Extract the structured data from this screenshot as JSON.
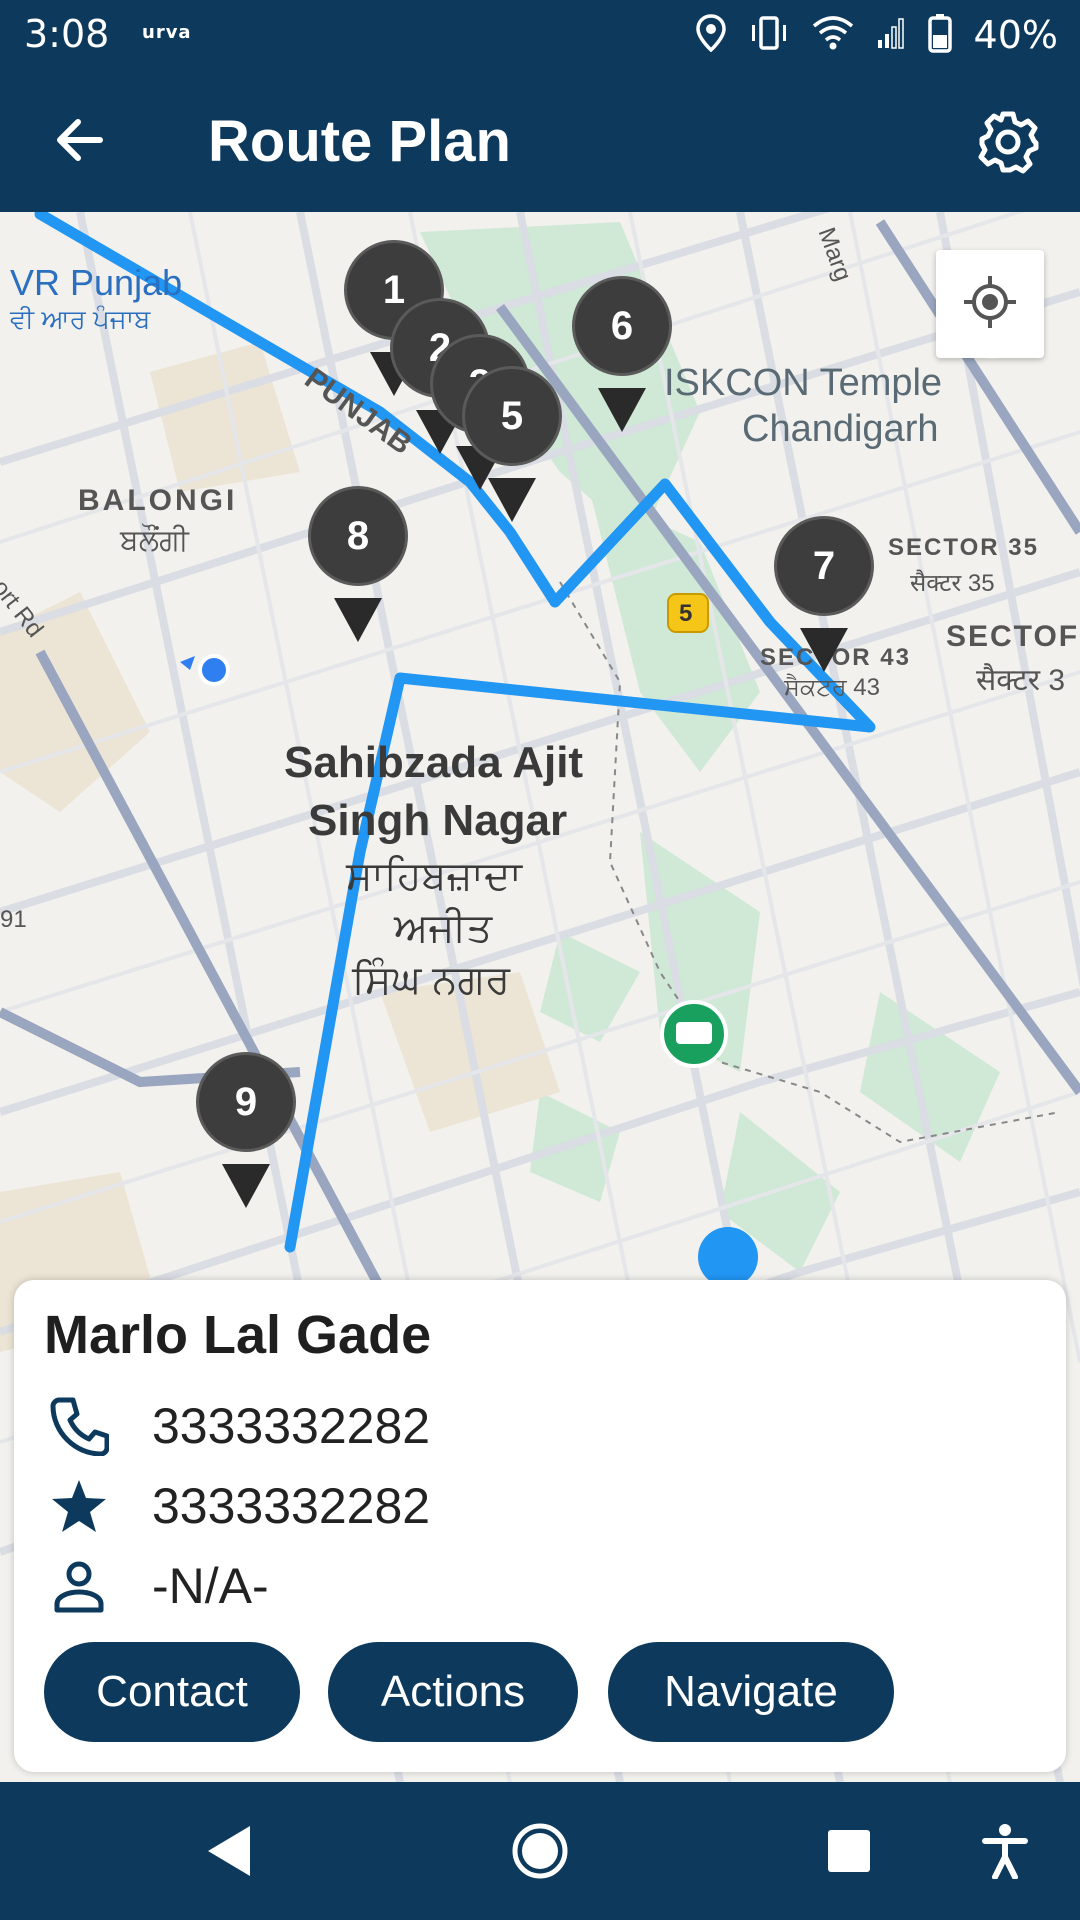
{
  "status_bar": {
    "time": "3:08",
    "carrier": "urva",
    "battery": "40%",
    "icons": [
      "location-icon",
      "vibrate-icon",
      "wifi-icon",
      "signal-icon",
      "battery-icon"
    ]
  },
  "app_bar": {
    "title": "Route Plan",
    "back_icon": "arrow-back-icon",
    "settings_icon": "gear-icon"
  },
  "map": {
    "markers": [
      "1",
      "2",
      "3",
      "5",
      "6",
      "7",
      "8",
      "9"
    ],
    "labels": {
      "vr_punjab": "VR Punjab",
      "vr_punjab_pa": "ਵੀ ਆਰ ਪੰਜਾਬ",
      "balongi": "BALONGI",
      "balongi_pa": "ਬਲੌਂਗੀ",
      "punjab_road": "PUNJAB",
      "iskcon": "ISKCON Temple",
      "iskcon2": "Chandigarh",
      "sector35": "SECTOR 35",
      "sector35_hi": "सैक्टर 35",
      "sector43": "SECTOR 43",
      "sector43_pa": "ਸੈਕਟਰ 43",
      "sector_edge": "SECTOF",
      "sector_edge_hi": "सैक्टर 3",
      "city1": "Sahibzada Ajit",
      "city2": "Singh Nagar",
      "city_pa1": "ਸਾਹਿਬਜ਼ਾਦਾ",
      "city_pa2": "ਅਜੀਤ",
      "city_pa3": "ਸਿੰਘ ਨਗਰ",
      "airport_rd": "port Rd",
      "marg": "Marg",
      "road_badge": "5",
      "edge_91": "91"
    },
    "route_color": "#2196f3"
  },
  "card": {
    "name": "Marlo Lal Gade",
    "phone": "3333332282",
    "alt_phone": "3333332282",
    "contact_person": "-N/A-",
    "buttons": {
      "contact": "Contact",
      "actions": "Actions",
      "navigate": "Navigate"
    }
  },
  "nav_bar": {
    "icons": [
      "back-triangle-icon",
      "home-circle-icon",
      "recents-square-icon",
      "accessibility-icon"
    ]
  },
  "colors": {
    "primary": "#0d3a5c",
    "route": "#2196f3",
    "marker": "#3d3d3d"
  }
}
